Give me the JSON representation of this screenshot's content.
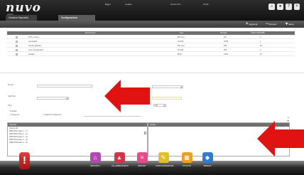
{
  "header": {
    "logo": "nuvo",
    "logo_sub": "network",
    "info1": "Bagni",
    "info2": "Cuadro",
    "info3": "10.0.0.171",
    "info4": "10:42",
    "tabs": [
      {
        "label": "Gestione Dispositivi"
      },
      {
        "label": "Configurazione"
      }
    ]
  },
  "toolbar": {
    "add_label": "Aggiungi",
    "remove_label": "Rimuovi",
    "save_label": "Salva"
  },
  "table": {
    "columns": [
      "Descrizione",
      "Tipo",
      "Modello",
      "Indirizzo/RS485"
    ],
    "rows": [
      {
        "name": "CTS_Luce1",
        "type": "Dimmer",
        "model": "DV",
        "addr": "4"
      },
      {
        "name": "Ventola01",
        "type": "On/Off",
        "model": "UPM",
        "addr": "1"
      },
      {
        "name": "Faretti giardino",
        "type": "Dimmer",
        "model": "DM",
        "addr": "18"
      },
      {
        "name": "Luce via giardino",
        "type": "On/Off",
        "model": "RM",
        "addr": "3"
      },
      {
        "name": "Scalda",
        "type": "Relè",
        "model": "UPM",
        "addr": "14"
      }
    ]
  },
  "form": {
    "label1": "Nome",
    "label2": "Indirizzo",
    "label3": "Tipo",
    "label4": "Canale",
    "tipo_value": "RM",
    "check1": "Supporto",
    "check2": "Attivati al Supporto",
    "minus": "−",
    "plus": "+",
    "dropdown_text": "Scenario"
  },
  "panels": {
    "left_header": "Ingressi",
    "right_header": "Uscite",
    "left_items": [
      "Interno 01",
      "INPUT01 (rilev 1 - 1)",
      "INPUT02 (rilev 1 - 2)",
      "INPUT03 (rilev 1 - 3)",
      "INPUT04 (rilev 1 - 4)",
      "INPUT05 (rilev 1 - 5)"
    ]
  },
  "dock": {
    "items": [
      {
        "label": "IMPIANTO",
        "icon": "house-icon",
        "color": "#b04ab0"
      },
      {
        "label": "ALLARME/EVENTI",
        "icon": "alarm-icon",
        "color": "#d6334a"
      },
      {
        "label": "REPORT",
        "icon": "report-icon",
        "color": "#e84a8a"
      },
      {
        "label": "CONFIGURAZIONE",
        "icon": "wrench-icon",
        "color": "#e0c02a"
      },
      {
        "label": "ATTIVITÀ",
        "icon": "calendar-icon",
        "color": "#eba024"
      },
      {
        "label": "DESIGN",
        "icon": "design-icon",
        "color": "#2e7cd0"
      }
    ]
  },
  "colors": {
    "arrow_red": "#e01212",
    "header_dark": "#1a1a1a"
  }
}
